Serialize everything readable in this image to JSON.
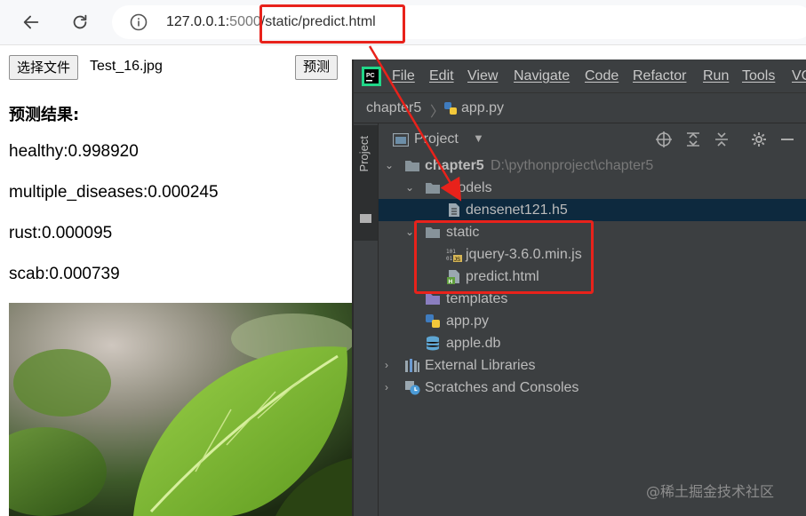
{
  "browser": {
    "url_host": "127.0.0.1:",
    "url_port": "5000",
    "url_path": "/static/predict.html",
    "icons": [
      "back-icon",
      "reload-icon",
      "info-icon"
    ]
  },
  "page": {
    "choose_file_label": "选择文件",
    "file_name": "Test_16.jpg",
    "predict_label": "预测",
    "result_title": "预测结果:",
    "results": [
      "healthy:0.998920",
      "multiple_diseases:0.000245",
      "rust:0.000095",
      "scab:0.000739"
    ]
  },
  "ide": {
    "menu": [
      "File",
      "Edit",
      "View",
      "Navigate",
      "Code",
      "Refactor",
      "Run",
      "Tools",
      "VC"
    ],
    "breadcrumb": [
      "chapter5",
      "app.py"
    ],
    "side_tab": "Project",
    "panel_title": "Project",
    "tree": {
      "root_name": "chapter5",
      "root_path": "D:\\pythonproject\\chapter5",
      "models_folder": "models",
      "model_file": "densenet121.h5",
      "static_folder": "static",
      "jquery_file": "jquery-3.6.0.min.js",
      "predict_file": "predict.html",
      "templates_folder": "templates",
      "app_file": "app.py",
      "db_file": "apple.db",
      "external_libs": "External Libraries",
      "scratches": "Scratches and Consoles"
    }
  },
  "annotation": {
    "highlight_color": "#e8221b",
    "watermark": "@稀土掘金技术社区"
  },
  "colors": {
    "ide_bg": "#3c3f41",
    "selected_row": "#0d293e",
    "folder": "#87939a",
    "leaf_green": "#7fbf2e"
  }
}
